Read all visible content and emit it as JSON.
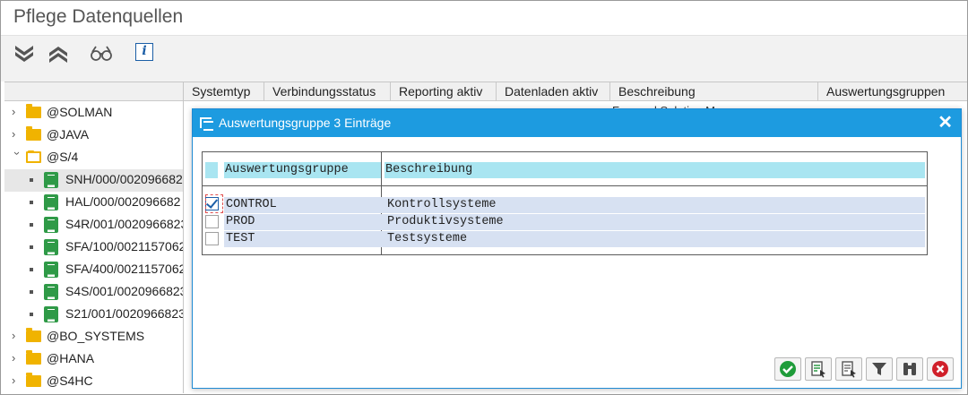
{
  "window": {
    "title": "Pflege Datenquellen"
  },
  "toolbar": {
    "icons": [
      "expand-all-icon",
      "collapse-all-icon",
      "display-glasses-icon",
      "info-icon"
    ],
    "info_glyph": "i"
  },
  "tree": {
    "items": [
      {
        "label": "@SOLMAN",
        "type": "folder"
      },
      {
        "label": "@JAVA",
        "type": "folder"
      },
      {
        "label": "@S/4",
        "type": "folder-open"
      },
      {
        "label": "SNH/000/002096682",
        "type": "system"
      },
      {
        "label": "HAL/000/002096682",
        "type": "system"
      },
      {
        "label": "S4R/001/0020966823",
        "type": "system"
      },
      {
        "label": "SFA/100/0021157062",
        "type": "system"
      },
      {
        "label": "SFA/400/0021157062",
        "type": "system"
      },
      {
        "label": "S4S/001/0020966823",
        "type": "system"
      },
      {
        "label": "S21/001/0020966823",
        "type": "system"
      },
      {
        "label": "@BO_SYSTEMS",
        "type": "folder"
      },
      {
        "label": "@HANA",
        "type": "folder"
      },
      {
        "label": "@S4HC",
        "type": "folder"
      }
    ]
  },
  "grid": {
    "columns": [
      "Systemtyp",
      "Verbindungsstatus",
      "Reporting aktiv",
      "Datenladen aktiv",
      "Beschreibung",
      "Auswertungsgruppen"
    ],
    "peek_text": "Focused Solution Manager"
  },
  "dialog": {
    "title": "Auswertungsgruppe 3 Einträge",
    "close_glyph": "✕",
    "headers": {
      "group": "Auswertungsgruppe",
      "description": "Beschreibung"
    },
    "rows": [
      {
        "group": "CONTROL",
        "description": "Kontrollsysteme",
        "checked": true
      },
      {
        "group": "PROD",
        "description": "Produktivsysteme",
        "checked": false
      },
      {
        "group": "TEST",
        "description": "Testsysteme",
        "checked": false
      }
    ],
    "buttons": [
      "confirm-icon",
      "select-all-icon",
      "deselect-all-icon",
      "filter-icon",
      "find-icon",
      "cancel-icon"
    ]
  },
  "colors": {
    "dialog_title": "#1d9be0",
    "header_cell": "#a9e5f1",
    "row": "#d7e1f2",
    "confirm": "#1f9c3a",
    "cancel": "#d0202a"
  }
}
